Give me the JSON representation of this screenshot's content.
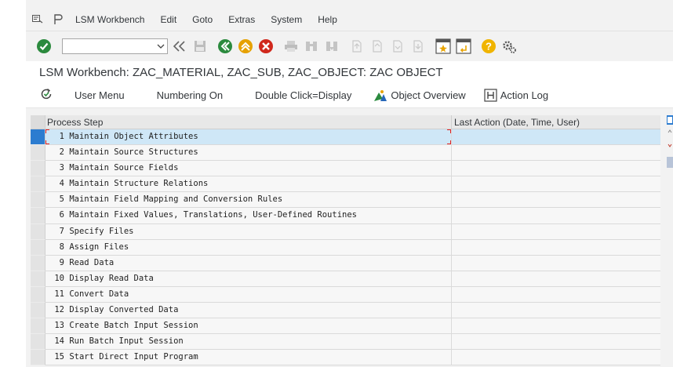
{
  "menu": {
    "items": [
      {
        "label": "LSM Workbench",
        "name": "menu-lsm-workbench"
      },
      {
        "label": "Edit",
        "name": "menu-edit"
      },
      {
        "label": "Goto",
        "name": "menu-goto"
      },
      {
        "label": "Extras",
        "name": "menu-extras"
      },
      {
        "label": "System",
        "name": "menu-system"
      },
      {
        "label": "Help",
        "name": "menu-help"
      }
    ]
  },
  "toolbar": {
    "command_value": ""
  },
  "title": "LSM Workbench: ZAC_MATERIAL, ZAC_SUB, ZAC_OBJECT: ZAC OBJECT",
  "app_toolbar": {
    "user_menu": "User Menu",
    "numbering_on": "Numbering On",
    "double_click": "Double Click=Display",
    "object_overview": "Object Overview",
    "action_log": "Action Log"
  },
  "table": {
    "columns": [
      "Process Step",
      "Last Action (Date, Time, User)"
    ],
    "rows": [
      {
        "num": "1",
        "step": "Maintain Object Attributes",
        "last": ""
      },
      {
        "num": "2",
        "step": "Maintain Source Structures",
        "last": ""
      },
      {
        "num": "3",
        "step": "Maintain Source Fields",
        "last": ""
      },
      {
        "num": "4",
        "step": "Maintain Structure Relations",
        "last": ""
      },
      {
        "num": "5",
        "step": "Maintain Field Mapping and Conversion Rules",
        "last": ""
      },
      {
        "num": "6",
        "step": "Maintain Fixed Values, Translations, User-Defined Routines",
        "last": ""
      },
      {
        "num": "7",
        "step": "Specify Files",
        "last": ""
      },
      {
        "num": "8",
        "step": "Assign Files",
        "last": ""
      },
      {
        "num": "9",
        "step": "Read Data",
        "last": ""
      },
      {
        "num": "10",
        "step": "Display Read Data",
        "last": ""
      },
      {
        "num": "11",
        "step": "Convert Data",
        "last": ""
      },
      {
        "num": "12",
        "step": "Display Converted Data",
        "last": ""
      },
      {
        "num": "13",
        "step": "Create Batch Input Session",
        "last": ""
      },
      {
        "num": "14",
        "step": "Run Batch Input Session",
        "last": ""
      },
      {
        "num": "15",
        "step": "Start Direct Input Program",
        "last": ""
      }
    ]
  },
  "colors": {
    "selected_row": "#cfe7f7",
    "row_marker": "#2c7cd0",
    "focus_corner": "#e02020"
  }
}
